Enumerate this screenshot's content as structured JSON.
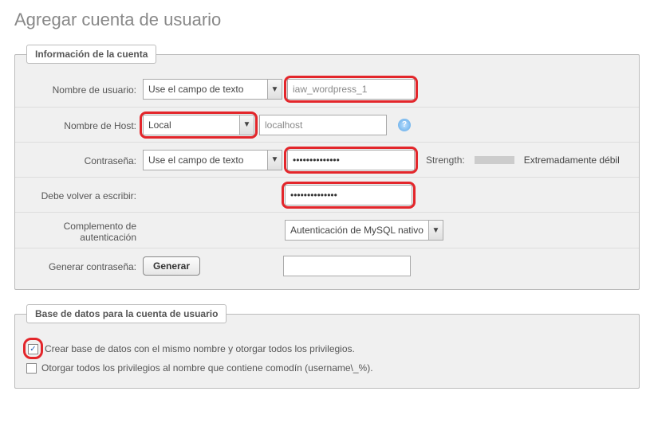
{
  "page": {
    "title": "Agregar cuenta de usuario"
  },
  "account": {
    "legend": "Información de la cuenta",
    "username": {
      "label": "Nombre de usuario:",
      "mode": "Use el campo de texto",
      "value": "iaw_wordpress_1"
    },
    "host": {
      "label": "Nombre de Host:",
      "mode": "Local",
      "value": "localhost"
    },
    "password": {
      "label": "Contraseña:",
      "mode": "Use el campo de texto",
      "value": "••••••••••••••",
      "strength_label": "Strength:",
      "strength_text": "Extremadamente débil"
    },
    "retype": {
      "label": "Debe volver a escribir:",
      "value": "••••••••••••••"
    },
    "auth_plugin": {
      "label": "Complemento de autenticación",
      "value": "Autenticación de MySQL nativo"
    },
    "generate": {
      "label": "Generar contraseña:",
      "button": "Generar",
      "value": ""
    }
  },
  "database": {
    "legend": "Base de datos para la cuenta de usuario",
    "opt_create_same": "Crear base de datos con el mismo nombre y otorgar todos los privilegios.",
    "opt_wildcard": "Otorgar todos los privilegios al nombre que contiene comodín (username\\_%)."
  }
}
